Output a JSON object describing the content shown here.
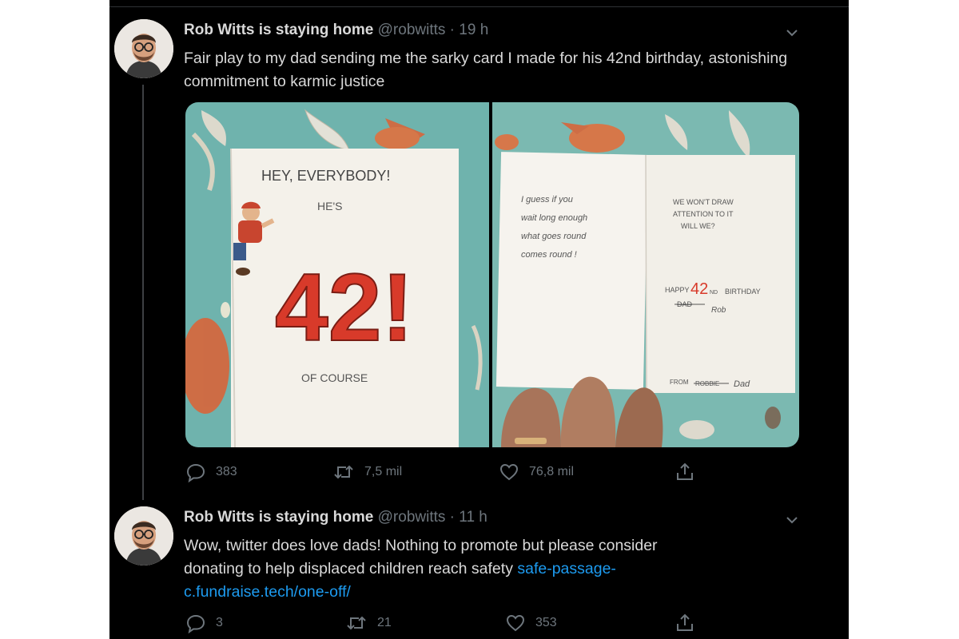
{
  "tweets": [
    {
      "display_name": "Rob Witts is staying home",
      "handle": "@robwitts",
      "separator": "·",
      "time": "19 h",
      "text": "Fair play to my dad sending me the sarky card I made for his 42nd birthday, astonishing commitment to karmic justice",
      "card": {
        "front_line1": "HEY, EVERYBODY!",
        "front_line2": "HE'S",
        "front_number": "42!",
        "front_line3": "OF COURSE",
        "inside_left": [
          "I guess if you",
          "wait long enough",
          "what goes round",
          "comes round !"
        ],
        "inside_right": [
          "WE WON'T DRAW",
          "ATTENTION TO IT",
          "WILL WE?"
        ],
        "happy": "HAPPY",
        "number": "42",
        "suffix": "ND",
        "birthday": "BIRTHDAY",
        "crossed": "DAD",
        "to_name": "Rob",
        "from_label": "FROM",
        "from_crossed": "ROBBIE",
        "from_name": "Dad"
      },
      "replies": "383",
      "retweets": "7,5 mil",
      "likes": "76,8 mil"
    },
    {
      "display_name": "Rob Witts is staying home",
      "handle": "@robwitts",
      "separator": "·",
      "time": "11 h",
      "text": "Wow, twitter does love dads! Nothing to promote but please consider donating to help displaced children reach safety",
      "link_line1": "safe-passage-",
      "link_line2": "c.fundraise.tech/one-off/",
      "replies": "3",
      "retweets": "21",
      "likes": "353"
    }
  ],
  "colors": {
    "background": "#000000",
    "text": "#d9d9d9",
    "muted": "#6e767d",
    "link": "#1d9bf0",
    "card_red": "#d83a2a",
    "wrap_teal": "#6fb3ad"
  },
  "icons": [
    "chevron-down-icon",
    "reply-icon",
    "retweet-icon",
    "like-icon",
    "share-icon"
  ]
}
